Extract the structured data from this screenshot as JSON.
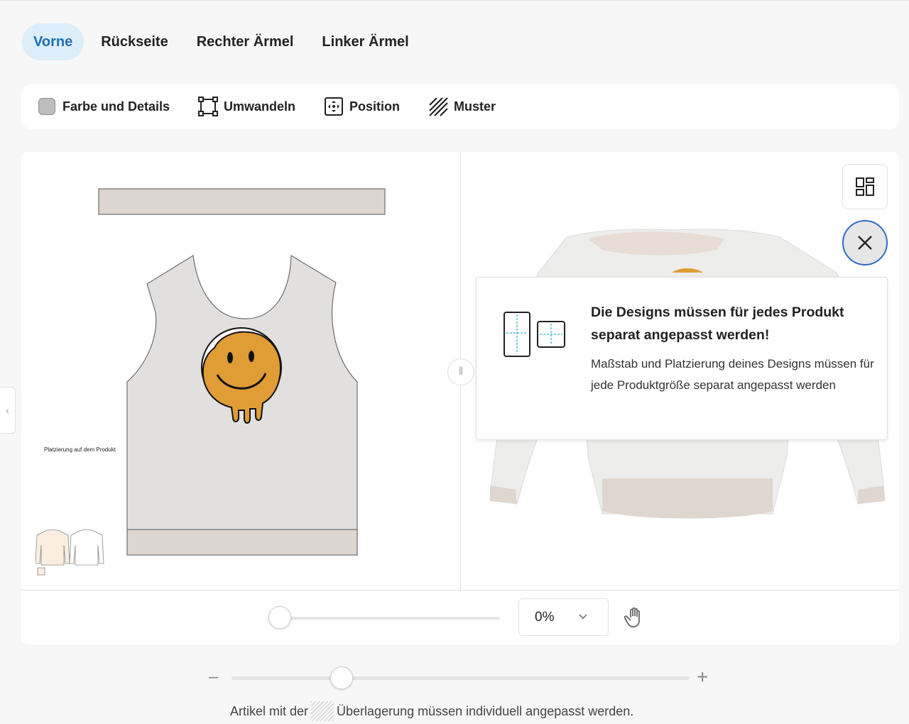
{
  "tabs": [
    {
      "label": "Vorne",
      "active": true
    },
    {
      "label": "Rückseite",
      "active": false
    },
    {
      "label": "Rechter Ärmel",
      "active": false
    },
    {
      "label": "Linker Ärmel",
      "active": false
    }
  ],
  "toolbar": {
    "color_label": "Farbe und Details",
    "transform_label": "Umwandeln",
    "position_label": "Position",
    "pattern_label": "Muster"
  },
  "editor": {
    "placement_label": "Platzierung auf dem Produkt"
  },
  "tooltip": {
    "title": "Die Designs müssen für jedes Produkt separat angepasst werden!",
    "body": "Maßstab und Platzierung deines Designs müssen für jede Produktgröße separat angepasst werden"
  },
  "controls": {
    "zoom_value": "0%",
    "bottom_slider_fraction": 0.24
  },
  "footnote": {
    "before": "Artikel mit der",
    "after": "Überlagerung müssen individuell angepasst werden."
  },
  "colors": {
    "accent": "#1e6fb3",
    "tab_active_bg": "#dbeef9",
    "fabric": "#e1e0de",
    "rib": "#ddd5d0",
    "smiley": "#e09c35"
  },
  "icons": [
    "swatch-icon",
    "transform-icon",
    "position-icon",
    "pattern-icon",
    "layout-grid-icon",
    "close-icon",
    "hand-icon",
    "chevron-down-icon",
    "split-handle-icon",
    "chevron-left-icon"
  ]
}
